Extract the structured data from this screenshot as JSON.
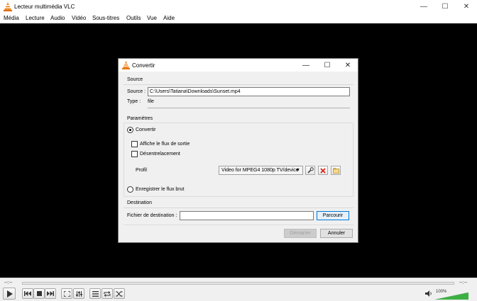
{
  "window": {
    "title": "Lecteur multimédia VLC",
    "minimize": "—",
    "maximize": "☐",
    "close": "✕"
  },
  "menu": [
    "Média",
    "Lecture",
    "Audio",
    "Vidéo",
    "Sous-titres",
    "Outils",
    "Vue",
    "Aide"
  ],
  "player": {
    "time_elapsed": "--:--",
    "time_total": "--:--",
    "volume": "100%",
    "volume_level": 1.0
  },
  "dialog": {
    "title": "Convertir",
    "minimize": "—",
    "maximize": "☐",
    "close": "✕",
    "source": {
      "section_label": "Source",
      "source_label": "Source :",
      "source_value": "C:\\Users\\Tatiana\\Downloads\\Sunset.mp4",
      "type_label": "Type :",
      "type_value": "file"
    },
    "params": {
      "section_label": "Paramètres",
      "convert_label": "Convertir",
      "show_output_label": "Affiche le flux de sortie",
      "deinterlace_label": "Désentrelacement",
      "profile_label": "Profil",
      "profile_value": "Video for MPEG4 1080p TV/device",
      "dump_raw_label": "Enregistrer le flux brut"
    },
    "destination": {
      "section_label": "Destination",
      "file_label": "Fichier de destination :",
      "file_value": "",
      "browse_label": "Parcourir"
    },
    "start_label": "Démarrer",
    "cancel_label": "Annuler"
  },
  "colors": {
    "vlc_orange": "#f28c28",
    "delete_red": "#d9261c",
    "volume_green": "#3cb043"
  }
}
